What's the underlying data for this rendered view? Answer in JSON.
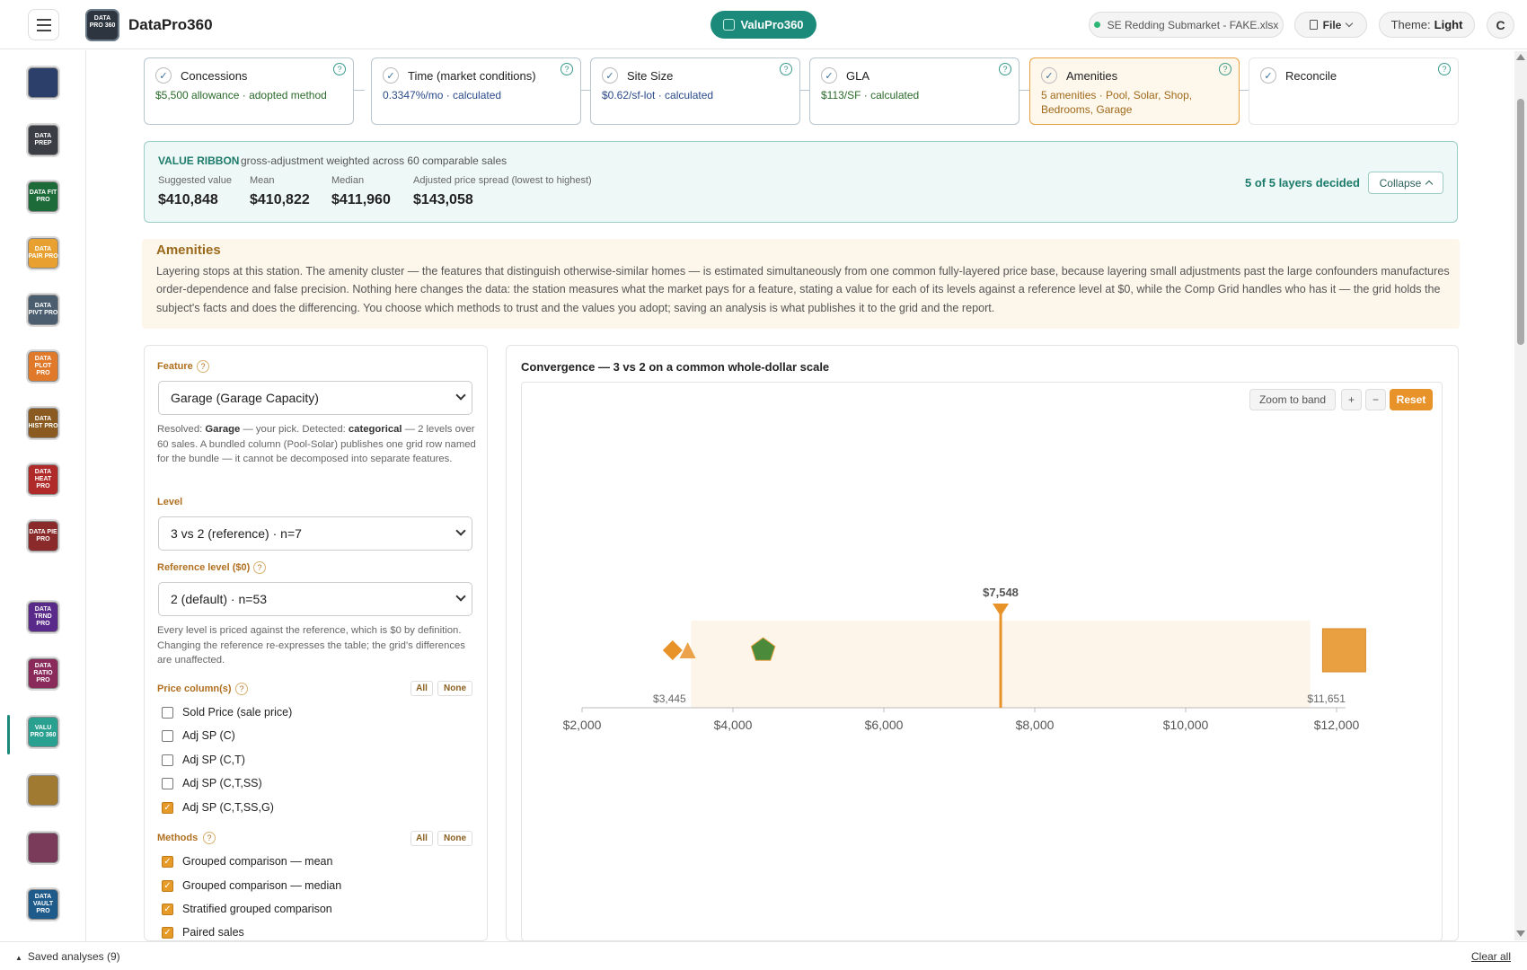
{
  "header": {
    "app_title": "DataPro360",
    "logo_text": "DATA PRO 360",
    "module_pill": "ValuPro360",
    "file_name": "SE Redding Submarket - FAKE.xlsx",
    "file_menu": "File",
    "theme_label": "Theme:",
    "theme_value": "Light",
    "avatar": "C"
  },
  "sidebar": {
    "items": [
      {
        "name": "home-icon",
        "text": "",
        "color": "#2c3e6a"
      },
      {
        "name": "data-prep-icon",
        "text": "DATA PREP",
        "color": "#3b3f45"
      },
      {
        "name": "data-fit-pro-icon",
        "text": "DATA FIT PRO",
        "color": "#1e6b3a"
      },
      {
        "name": "data-pair-pro-icon",
        "text": "DATA PAIR PRO",
        "color": "#e8a030"
      },
      {
        "name": "data-pivt-pro-icon",
        "text": "DATA PIVT PRO",
        "color": "#4a5e70"
      },
      {
        "name": "data-plot-pro-icon",
        "text": "DATA PLOT PRO",
        "color": "#e07a2a"
      },
      {
        "name": "data-hist-pro-icon",
        "text": "DATA HIST PRO",
        "color": "#8a5a20"
      },
      {
        "name": "data-heat-pro-icon",
        "text": "DATA HEAT PRO",
        "color": "#b02a2a"
      },
      {
        "name": "data-pie-pro-icon",
        "text": "DATA PIE PRO",
        "color": "#8a2a2a"
      },
      {
        "name": "data-trnd-pro-icon",
        "text": "DATA TRND PRO",
        "color": "#5a2a8a"
      },
      {
        "name": "data-ratio-pro-icon",
        "text": "DATA RATIO PRO",
        "color": "#8a2a5a"
      },
      {
        "name": "valu-pro-360-icon",
        "text": "VALU PRO 360",
        "color": "#2aa090"
      },
      {
        "name": "grid-report-icon",
        "text": "",
        "color": "#a07a30"
      },
      {
        "name": "bar-report-icon",
        "text": "",
        "color": "#7a3a5a"
      },
      {
        "name": "data-vault-pro-icon",
        "text": "DATA VAULT PRO",
        "color": "#1e5a8a"
      }
    ]
  },
  "steps": [
    {
      "title": "Concessions",
      "sub": "$5,500 allowance · adopted method",
      "color": "#2a6a2a"
    },
    {
      "title": "Time (market conditions)",
      "sub": "0.3347%/mo · calculated",
      "color": "#2a4a8a"
    },
    {
      "title": "Site Size",
      "sub": "$0.62/sf-lot · calculated",
      "color": "#2a4a8a"
    },
    {
      "title": "GLA",
      "sub": "$113/SF · calculated",
      "color": "#2a6a2a"
    },
    {
      "title": "Amenities",
      "sub": "5 amenities · Pool, Solar, Shop, Bedrooms, Garage",
      "color": "#a06a1a"
    },
    {
      "title": "Reconcile",
      "sub": "",
      "color": "#333"
    }
  ],
  "ribbon": {
    "title": "VALUE RIBBON",
    "subtitle": "gross-adjustment weighted across 60 comparable sales",
    "suggested_label": "Suggested value",
    "suggested_value": "$410,848",
    "mean_label": "Mean",
    "mean_value": "$410,822",
    "median_label": "Median",
    "median_value": "$411,960",
    "spread_label": "Adjusted price spread (lowest to highest)",
    "spread_value": "$143,058",
    "status": "5 of 5 layers decided",
    "collapse": "Collapse"
  },
  "amenities": {
    "title": "Amenities",
    "description": "Layering stops at this station. The amenity cluster — the features that distinguish otherwise-similar homes — is estimated simultaneously from one common fully-layered price base, because layering small adjustments past the large confounders manufactures order-dependence and false precision. Nothing here changes the data: the station measures what the market pays for a feature, stating a value for each of its levels against a reference level at $0, while the Comp Grid handles who has it — the grid holds the subject's facts and does the differencing. You choose which methods to trust and the values you adopt; saving an analysis is what publishes it to the grid and the report."
  },
  "form": {
    "feature_label": "Feature",
    "feature_value": "Garage (Garage Capacity)",
    "resolved_prefix": "Resolved:",
    "resolved_feature": "Garage",
    "resolved_mid": "— your pick. Detected:",
    "resolved_type": "categorical",
    "resolved_rest": "— 2 levels over 60 sales. A bundled column (Pool-Solar) publishes one grid row named for the bundle — it cannot be decomposed into separate features.",
    "level_label": "Level",
    "level_value": "3 vs 2 (reference) · n=7",
    "ref_label": "Reference level ($0)",
    "ref_value": "2 (default) · n=53",
    "ref_help": "Every level is priced against the reference, which is $0 by definition. Changing the reference re-expresses the table; the grid's differences are unaffected.",
    "price_label": "Price column(s)",
    "all": "All",
    "none": "None",
    "price_columns": [
      {
        "label": "Sold Price (sale price)",
        "checked": false
      },
      {
        "label": "Adj SP (C)",
        "checked": false
      },
      {
        "label": "Adj SP (C,T)",
        "checked": false
      },
      {
        "label": "Adj SP (C,T,SS)",
        "checked": false
      },
      {
        "label": "Adj SP (C,T,SS,G)",
        "checked": true
      }
    ],
    "methods_label": "Methods",
    "methods": [
      {
        "label": "Grouped comparison — mean",
        "checked": true
      },
      {
        "label": "Grouped comparison — median",
        "checked": true
      },
      {
        "label": "Stratified grouped comparison",
        "checked": true
      },
      {
        "label": "Paired sales",
        "checked": true
      }
    ]
  },
  "convergence": {
    "title": "Convergence — 3 vs 2 on a common whole-dollar scale",
    "zoom_band": "Zoom to band",
    "zoom_in": "+",
    "zoom_out": "−",
    "reset": "Reset"
  },
  "chart_data": {
    "type": "scatter",
    "x_ticks": [
      2000,
      4000,
      6000,
      8000,
      10000,
      12000
    ],
    "x_tick_labels": [
      "$2,000",
      "$4,000",
      "$6,000",
      "$8,000",
      "$10,000",
      "$12,000"
    ],
    "xlim": [
      2000,
      12000
    ],
    "band": {
      "low": 3445,
      "high": 11651,
      "low_label": "$3,445",
      "high_label": "$11,651"
    },
    "adopted": {
      "value": 7548,
      "label": "$7,548"
    },
    "points": [
      {
        "x": 3200,
        "shape": "diamond",
        "color": "#e8922a"
      },
      {
        "x": 3400,
        "shape": "triangle",
        "color": "#e8922a"
      },
      {
        "x": 4400,
        "shape": "pentagon",
        "color": "#4a8a3a"
      },
      {
        "x": 12100,
        "shape": "square",
        "color": "#e8a040"
      }
    ]
  },
  "footer": {
    "saved": "Saved analyses (9)",
    "clear": "Clear all"
  }
}
